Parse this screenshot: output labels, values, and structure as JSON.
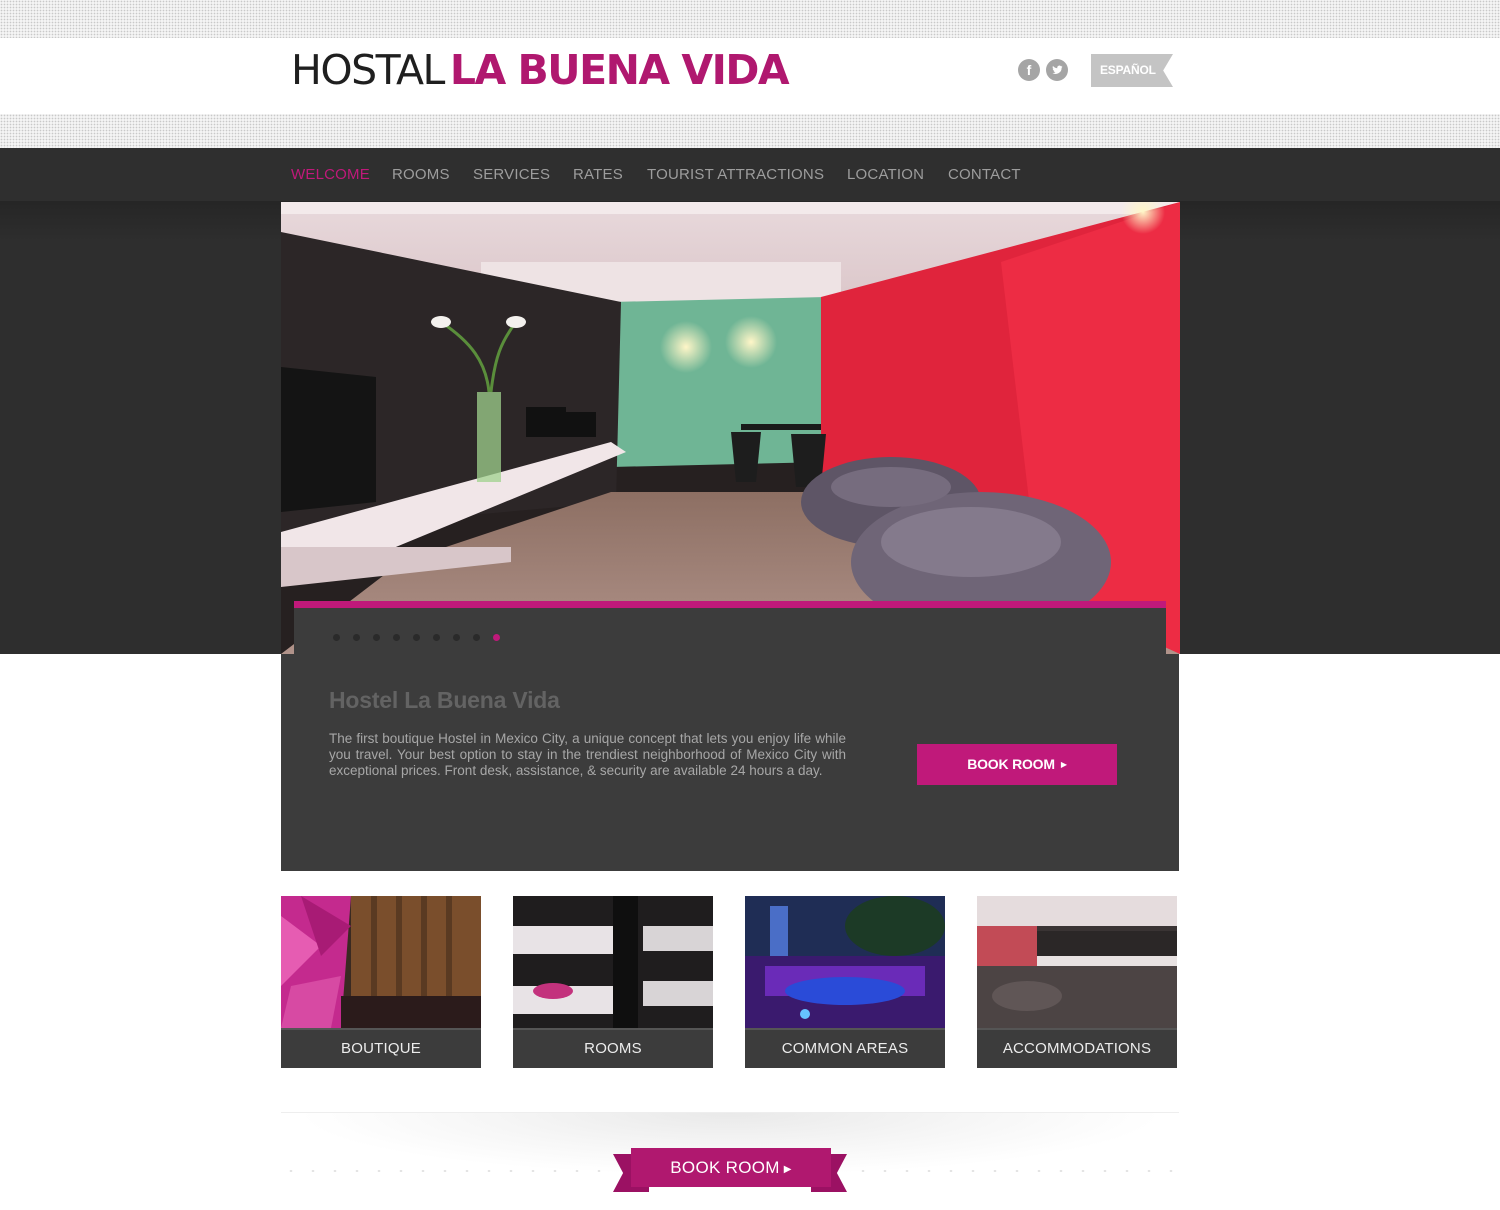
{
  "header": {
    "logo_light": "HOSTAL",
    "logo_bold": "LA BUENA VIDA",
    "social": [
      {
        "icon": "facebook-icon",
        "glyph": "f"
      },
      {
        "icon": "twitter-icon",
        "glyph": "t"
      }
    ],
    "language_label": "ESPAÑOL"
  },
  "nav": {
    "items": [
      {
        "label": "WELCOME",
        "active": true
      },
      {
        "label": "ROOMS",
        "active": false
      },
      {
        "label": "SERVICES",
        "active": false
      },
      {
        "label": "RATES",
        "active": false
      },
      {
        "label": "TOURIST ATTRACTIONS",
        "active": false
      },
      {
        "label": "LOCATION",
        "active": false
      },
      {
        "label": "CONTACT",
        "active": false
      }
    ]
  },
  "slider": {
    "slide_count": 9,
    "active_index": 8
  },
  "intro": {
    "title": "Hostel La Buena Vida",
    "text": "The first boutique Hostel in Mexico City, a unique concept that lets you enjoy life while you travel. Your best option to stay in the trendiest neighborhood of Mexico City with exceptional prices. Front desk, assistance, & security are available 24 hours a day.",
    "book_label": "BOOK ROOM"
  },
  "tiles": [
    {
      "label": "BOUTIQUE"
    },
    {
      "label": "ROOMS"
    },
    {
      "label": "COMMON AREAS"
    },
    {
      "label": "ACCOMMODATIONS"
    }
  ],
  "footer": {
    "book_label": "BOOK ROOM"
  },
  "colors": {
    "accent": "#c0197a",
    "nav_bg": "#2f2f2f",
    "panel_bg": "#3c3c3c"
  }
}
